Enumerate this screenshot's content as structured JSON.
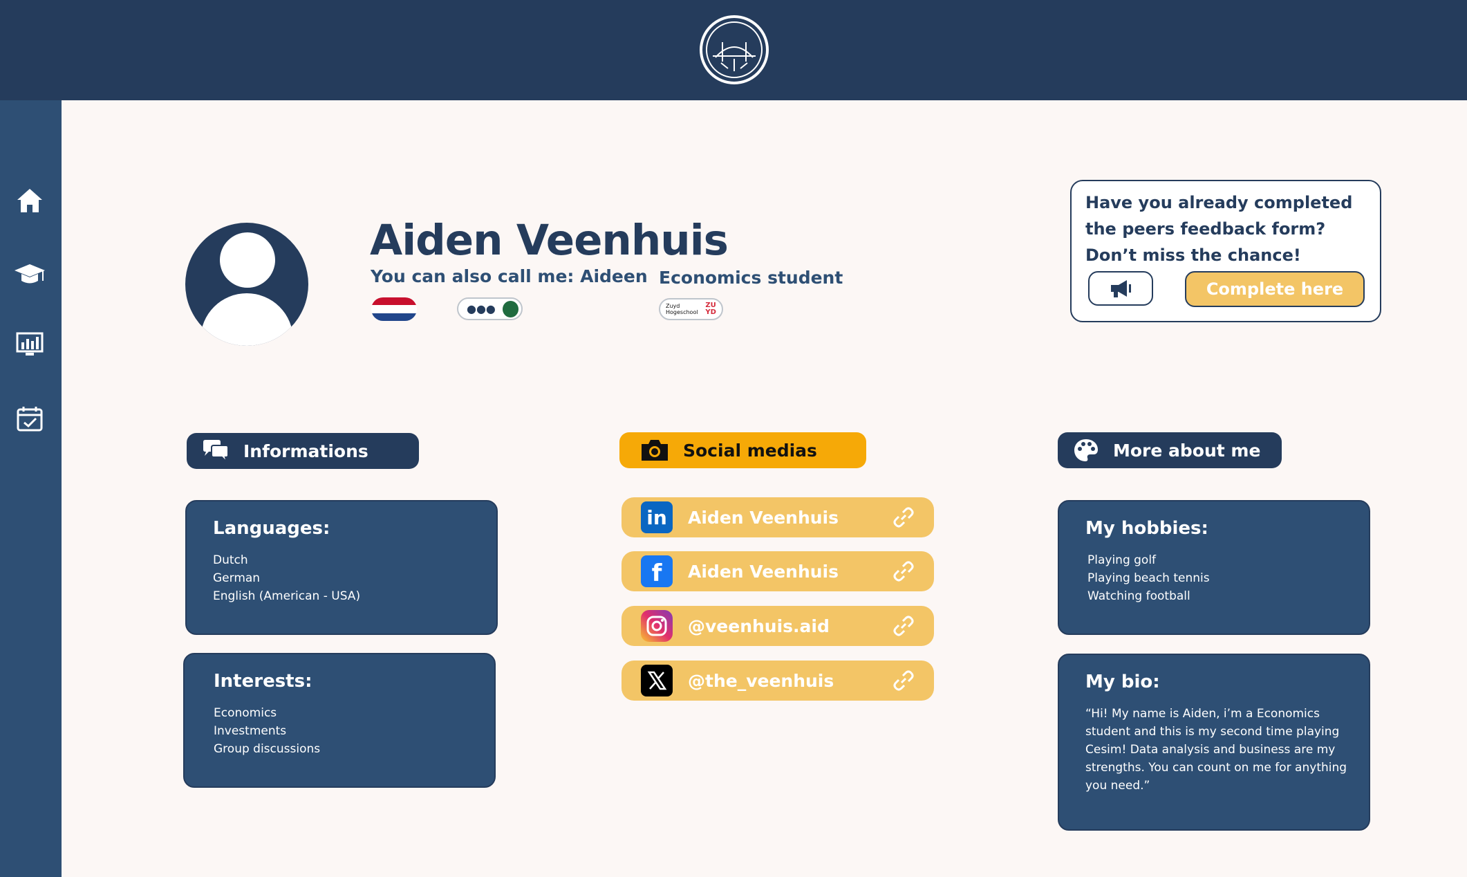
{
  "profile": {
    "name": "Aiden Veenhuis",
    "nickname": "You can also call me: Aideen",
    "study": "Economics student",
    "school_name": "Zuyd Hogeschool",
    "school_brand": "ZU YD"
  },
  "feedback": {
    "text": "Have you already  completed the peers feedback form? Don’t miss the chance!",
    "button": "Complete here"
  },
  "sections": {
    "informations": "Informations",
    "social_medias": "Social medias",
    "more_about_me": "More about me"
  },
  "languages": {
    "title": "Languages:",
    "items": [
      "Dutch",
      "German",
      "English (American - USA)"
    ]
  },
  "interests": {
    "title": "Interests:",
    "items": [
      "Economics",
      "Investments",
      "Group discussions"
    ]
  },
  "socials": [
    {
      "platform": "linkedin-icon",
      "handle": "Aiden Veenhuis"
    },
    {
      "platform": "facebook-icon",
      "handle": "Aiden Veenhuis"
    },
    {
      "platform": "instagram-icon",
      "handle": "@veenhuis.aid"
    },
    {
      "platform": "x-icon",
      "handle": "@the_veenhuis"
    }
  ],
  "hobbies": {
    "title": "My hobbies:",
    "items": [
      "Playing golf",
      "Playing beach tennis",
      "Watching football"
    ]
  },
  "bio": {
    "title": "My bio:",
    "text": "“Hi! My name is Aiden, i’m a  Economics student and this is my second time playing Cesim! Data analysis and business are my strengths. You can count on me for anything you need.”"
  },
  "colors": {
    "navy": "#253c5c",
    "card_blue": "#2e4f74",
    "yellow": "#f3c566",
    "orange": "#f6a907",
    "background": "#fcf7f5"
  }
}
